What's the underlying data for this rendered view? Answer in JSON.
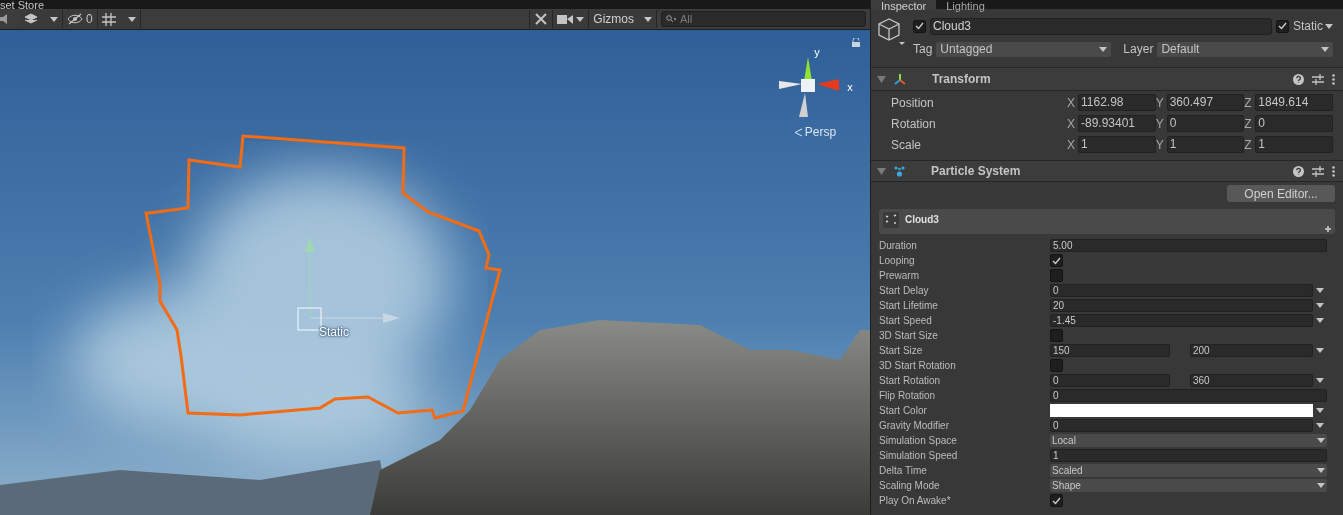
{
  "scene_tab_strip": {
    "title": "set Store"
  },
  "scene_toolbar": {
    "hidden_count": "0",
    "gizmos": "Gizmos",
    "search": {
      "placeholder": "All"
    }
  },
  "scene": {
    "object_label": "Static",
    "axis_y": "y",
    "axis_x": "x",
    "projection": "Persp"
  },
  "inspector_tabs": [
    {
      "label": "Inspector",
      "selected": true
    },
    {
      "label": "Lighting",
      "selected": false
    }
  ],
  "object": {
    "active": true,
    "name": "Cloud3",
    "static": true,
    "static_label": "Static",
    "tag_label": "Tag",
    "tag": "Untagged",
    "layer_label": "Layer",
    "layer": "Default"
  },
  "transform": {
    "title": "Transform",
    "expanded": true,
    "rows": [
      {
        "label": "Position",
        "fields": [
          {
            "axis": "X",
            "value": "1162.98"
          },
          {
            "axis": "Y",
            "value": "360.497"
          },
          {
            "axis": "Z",
            "value": "1849.614"
          }
        ]
      },
      {
        "label": "Rotation",
        "fields": [
          {
            "axis": "X",
            "value": "-89.93401"
          },
          {
            "axis": "Y",
            "value": "0"
          },
          {
            "axis": "Z",
            "value": "0"
          }
        ]
      },
      {
        "label": "Scale",
        "fields": [
          {
            "axis": "X",
            "value": "1"
          },
          {
            "axis": "Y",
            "value": "1"
          },
          {
            "axis": "Z",
            "value": "1"
          }
        ]
      }
    ]
  },
  "particle_system": {
    "title": "Particle System",
    "expanded": true,
    "open_editor": "Open Editor...",
    "module": "Cloud3",
    "properties": [
      {
        "label": "Duration",
        "kind": "field",
        "value": "5.00"
      },
      {
        "label": "Looping",
        "kind": "toggle",
        "checked": true
      },
      {
        "label": "Prewarm",
        "kind": "toggle",
        "checked": false
      },
      {
        "label": "Start Delay",
        "kind": "field_menu",
        "value": "0"
      },
      {
        "label": "Start Lifetime",
        "kind": "field_menu",
        "value": "20"
      },
      {
        "label": "Start Speed",
        "kind": "field_menu",
        "value": "-1.45"
      },
      {
        "label": "3D Start Size",
        "kind": "toggle",
        "checked": false
      },
      {
        "label": "Start Size",
        "kind": "pair_menu",
        "value": "150",
        "value2": "200"
      },
      {
        "label": "3D Start Rotation",
        "kind": "toggle",
        "checked": false
      },
      {
        "label": "Start Rotation",
        "kind": "pair_menu",
        "value": "0",
        "value2": "360"
      },
      {
        "label": "Flip Rotation",
        "kind": "field",
        "value": "0"
      },
      {
        "label": "Start Color",
        "kind": "color_menu",
        "color": "#ffffff"
      },
      {
        "label": "Gravity Modifier",
        "kind": "field_menu",
        "value": "0"
      },
      {
        "label": "Simulation Space",
        "kind": "dropdown",
        "value": "Local"
      },
      {
        "label": "Simulation Speed",
        "kind": "field",
        "value": "1"
      },
      {
        "label": "Delta Time",
        "kind": "dropdown",
        "value": "Scaled"
      },
      {
        "label": "Scaling Mode",
        "kind": "dropdown",
        "value": "Shape"
      },
      {
        "label": "Play On Awake*",
        "kind": "toggle",
        "checked": true
      }
    ]
  }
}
